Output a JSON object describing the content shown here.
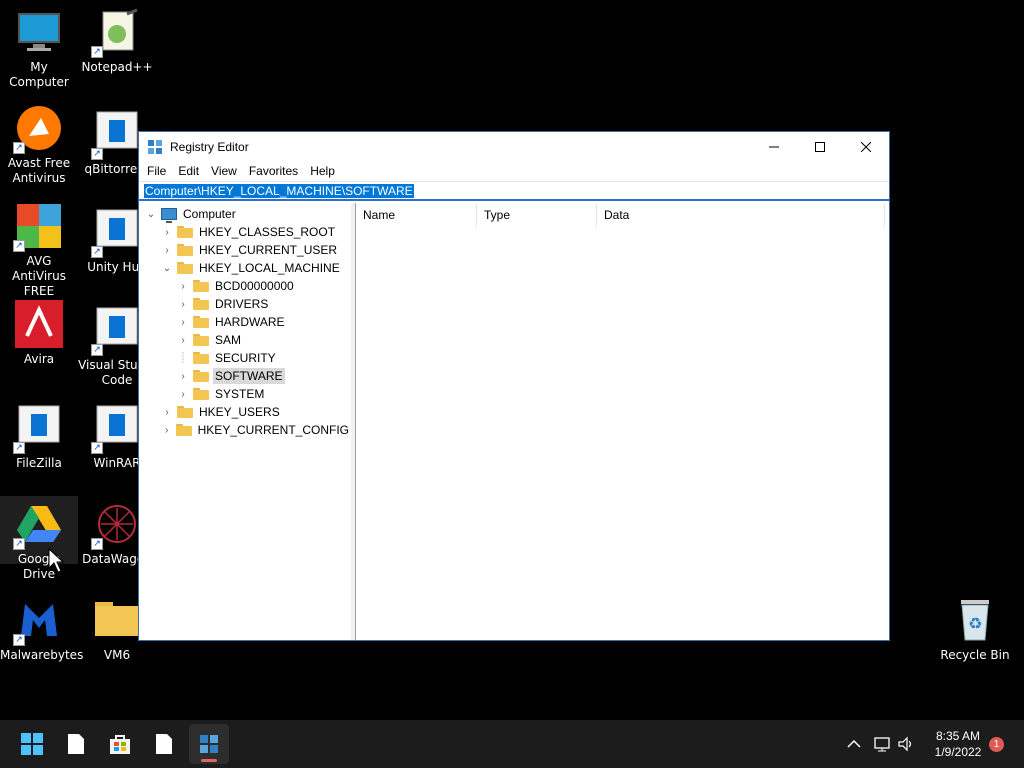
{
  "desktop": {
    "icons": [
      {
        "label": "My Computer"
      },
      {
        "label": "Notepad++"
      },
      {
        "label": "Avast Free Antivirus"
      },
      {
        "label": "qBittorrent"
      },
      {
        "label": "AVG AntiVirus FREE"
      },
      {
        "label": "Unity Hub"
      },
      {
        "label": "Avira"
      },
      {
        "label": "Visual Studio Code"
      },
      {
        "label": "FileZilla"
      },
      {
        "label": "WinRAR"
      },
      {
        "label": "Google Drive"
      },
      {
        "label": "DataWagon"
      },
      {
        "label": "Malwarebytes"
      },
      {
        "label": "VM6"
      },
      {
        "label": "Recycle Bin"
      }
    ]
  },
  "window": {
    "title": "Registry Editor",
    "menu": [
      "File",
      "Edit",
      "View",
      "Favorites",
      "Help"
    ],
    "address": "Computer\\HKEY_LOCAL_MACHINE\\SOFTWARE",
    "tree": {
      "root": "Computer",
      "hives": [
        "HKEY_CLASSES_ROOT",
        "HKEY_CURRENT_USER",
        "HKEY_LOCAL_MACHINE",
        "HKEY_USERS",
        "HKEY_CURRENT_CONFIG"
      ],
      "hklm_children": [
        "BCD00000000",
        "DRIVERS",
        "HARDWARE",
        "SAM",
        "SECURITY",
        "SOFTWARE",
        "SYSTEM"
      ],
      "selected": "SOFTWARE"
    },
    "columns": [
      "Name",
      "Type",
      "Data"
    ]
  },
  "taskbar": {
    "time": "8:35 AM",
    "date": "1/9/2022",
    "notification_count": "1"
  },
  "colors": {
    "accent": "#0078d7",
    "taskbar": "#1c1c1c",
    "folder": "#f3c653"
  }
}
